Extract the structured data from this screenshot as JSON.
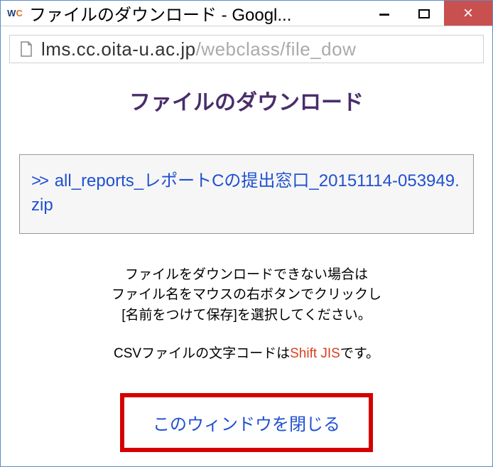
{
  "window": {
    "title": "ファイルのダウンロード - Googl...",
    "minimize_label": "–",
    "close_label": "×"
  },
  "address": {
    "host": "lms.cc.oita-u.ac.jp",
    "path": "/webclass/file_dow"
  },
  "page": {
    "heading": "ファイルのダウンロード",
    "file_prefix": ">>",
    "file_name": "all_reports_レポートCの提出窓口_20151114-053949.zip",
    "help_line1": "ファイルをダウンロードできない場合は",
    "help_line2": "ファイル名をマウスの右ボタンでクリックし",
    "help_line3": "[名前をつけて保存]を選択してください。",
    "encoding_prefix": "CSVファイルの文字コードは",
    "encoding_value": "Shift JIS",
    "encoding_suffix": "です。",
    "close_window": "このウィンドウを閉じる"
  }
}
